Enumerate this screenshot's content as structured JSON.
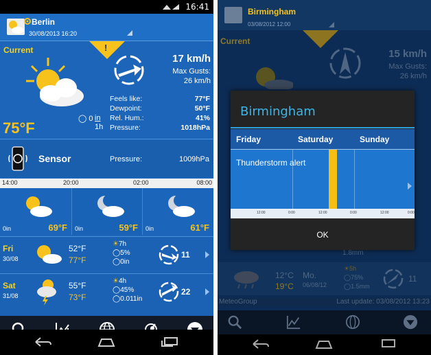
{
  "left": {
    "status": {
      "time": "16:41"
    },
    "header": {
      "city": "Berlin",
      "date": "30/08/2013 16:20"
    },
    "current": {
      "label": "Current",
      "temp": "75°F",
      "wind_speed": "17 km/h",
      "gusts_label": "Max Gusts:",
      "gusts_value": "26 km/h",
      "rain_amount": "0",
      "rain_unit_top": "in",
      "rain_unit_bottom": "1h",
      "details": [
        {
          "label": "Feels like:",
          "value": "77°F"
        },
        {
          "label": "Dewpoint:",
          "value": "50°F"
        },
        {
          "label": "Rel. Hum.:",
          "value": "41%"
        },
        {
          "label": "Pressure:",
          "value": "1018hPa"
        }
      ]
    },
    "sensor": {
      "label": "Sensor",
      "pressure_label": "Pressure:",
      "pressure_value": "1009hPa"
    },
    "timeline": [
      "14:00",
      "20:00",
      "02:00",
      "08:00"
    ],
    "hourly": [
      {
        "rain": "0in",
        "temp": "69°F",
        "icon": "sun-cloud-icon"
      },
      {
        "rain": "0in",
        "temp": "59°F",
        "icon": "moon-cloud-icon"
      },
      {
        "rain": "0in",
        "temp": "61°F",
        "icon": "moon-cloud-icon"
      }
    ],
    "days": [
      {
        "name": "Fri",
        "date": "30/08",
        "tmax": "52°F",
        "tmin": "77°F",
        "sun": "7h",
        "rain_pct": "5%",
        "rain_amt": "0in",
        "wind": "11"
      },
      {
        "name": "Sat",
        "date": "31/08",
        "tmax": "55°F",
        "tmin": "73°F",
        "sun": "4h",
        "rain_pct": "45%",
        "rain_amt": "0.011in",
        "wind": "22"
      }
    ],
    "toolbar": [
      "search-icon",
      "chart-icon",
      "globe-icon",
      "radar-icon",
      "menu-down-icon"
    ]
  },
  "right": {
    "header": {
      "city": "Birmingham",
      "date": "03/08/2012 12:00"
    },
    "current_label": "Current",
    "wind_speed": "15 km/h",
    "gusts_label": "Max Gusts:",
    "gusts_value": "26 km/h",
    "dialog": {
      "title": "Birmingham",
      "days": [
        "Friday",
        "Saturday",
        "Sunday"
      ],
      "alert": "Thunderstorm alert",
      "ruler": [
        "12:00",
        "0:00",
        "12:00",
        "0:00",
        "12:00",
        "0:00"
      ],
      "ok": "OK"
    },
    "background_rows": {
      "row1_rain": "1.8mm",
      "temp_hi": "12°C",
      "temp_lo": "19°C",
      "day_name": "Mo.",
      "day_date": "06/08/12",
      "sun": "5h",
      "rain_pct": "75%",
      "rain_amt": "1.5mm",
      "wind": "11"
    },
    "footer": {
      "left": "MeteoGroup",
      "right": "Last update: 03/08/2012 13:23"
    }
  },
  "colors": {
    "accent": "#f8c21d",
    "panel": "#1c65b8",
    "dialog_title": "#3fb4e6"
  }
}
